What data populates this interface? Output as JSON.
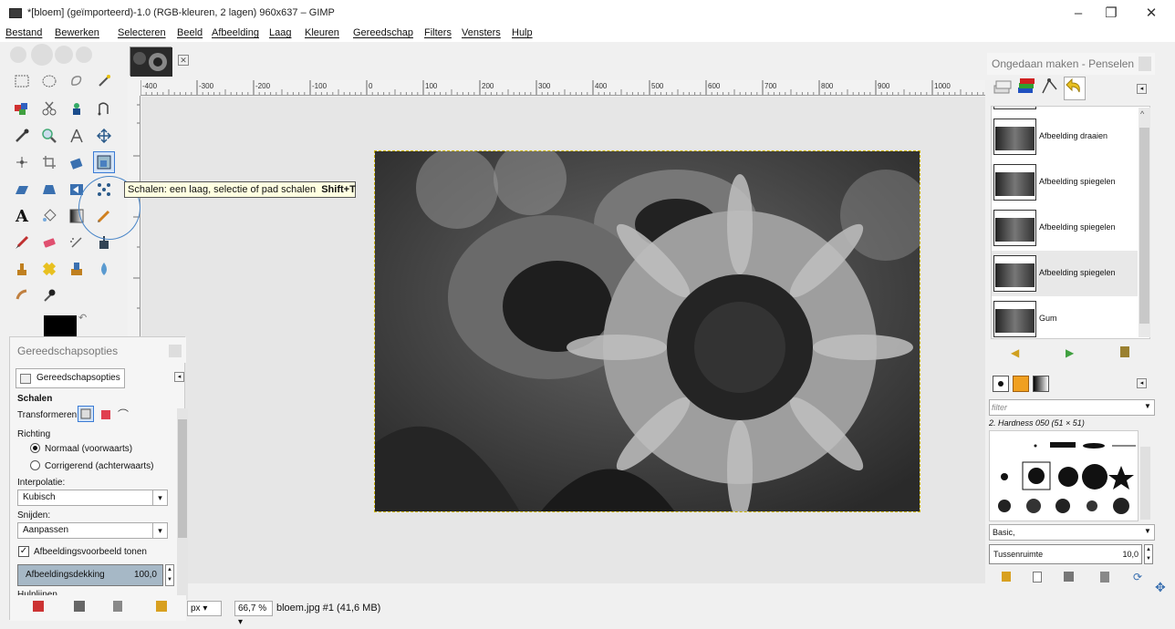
{
  "window": {
    "title": "*[bloem] (geïmporteerd)-1.0 (RGB-kleuren, 2 lagen) 960x637 – GIMP",
    "minimize": "–",
    "maximize": "❐",
    "close": "✕"
  },
  "menu": [
    "Bestand",
    "Bewerken",
    "Selecteren",
    "Beeld",
    "Afbeelding",
    "Laag",
    "Kleuren",
    "Gereedschap",
    "Filters",
    "Vensters",
    "Hulp"
  ],
  "tooltip": {
    "text": "Schalen: een laag, selectie of pad schalen",
    "shortcut": "Shift+T"
  },
  "image_tab": {
    "close": "✕"
  },
  "rulers": {
    "h_ticks": [
      "-400",
      "-300",
      "-200",
      "-100",
      "0",
      "100",
      "200",
      "300",
      "400",
      "500",
      "600",
      "700",
      "800",
      "900",
      "1000"
    ]
  },
  "statusbar": {
    "unit": "px",
    "zoom": "66,7 %",
    "info": "bloem.jpg #1 (41,6 MB)"
  },
  "tool_options": {
    "dock_title": "Gereedschapsopties",
    "tab_label": "Gereedschapsopties",
    "tool_name": "Schalen",
    "transform_label": "Transformeren:",
    "direction_label": "Richting",
    "direction_normal": "Normaal (voorwaarts)",
    "direction_corrective": "Corrigerend (achterwaarts)",
    "interpolation_label": "Interpolatie:",
    "interpolation_value": "Kubisch",
    "clipping_label": "Snijden:",
    "clipping_value": "Aanpassen",
    "preview_label": "Afbeeldingsvoorbeeld tonen",
    "opacity_label": "Afbeeldingsdekking",
    "opacity_value": "100,0",
    "guides_label": "Hulplijnen"
  },
  "right_dock": {
    "title": "Ongedaan maken - Penselen",
    "history": [
      {
        "label": ""
      },
      {
        "label": "Afbeelding draaien"
      },
      {
        "label": "Afbeelding spiegelen"
      },
      {
        "label": "Afbeelding spiegelen"
      },
      {
        "label": "Afbeelding spiegelen",
        "selected": true
      },
      {
        "label": "Gum"
      }
    ],
    "brush_filter_placeholder": "filter",
    "brush_name": "2. Hardness 050 (51 × 51)",
    "brush_preset": "Basic,",
    "spacing_label": "Tussenruimte",
    "spacing_value": "10,0"
  },
  "colors": {
    "accent": "#3a7bd5",
    "tooltip_bg": "#ffffe1",
    "selection_border": "#c8b000",
    "fg_color": "#000000",
    "opacity_bar": "#a6b8c6"
  }
}
